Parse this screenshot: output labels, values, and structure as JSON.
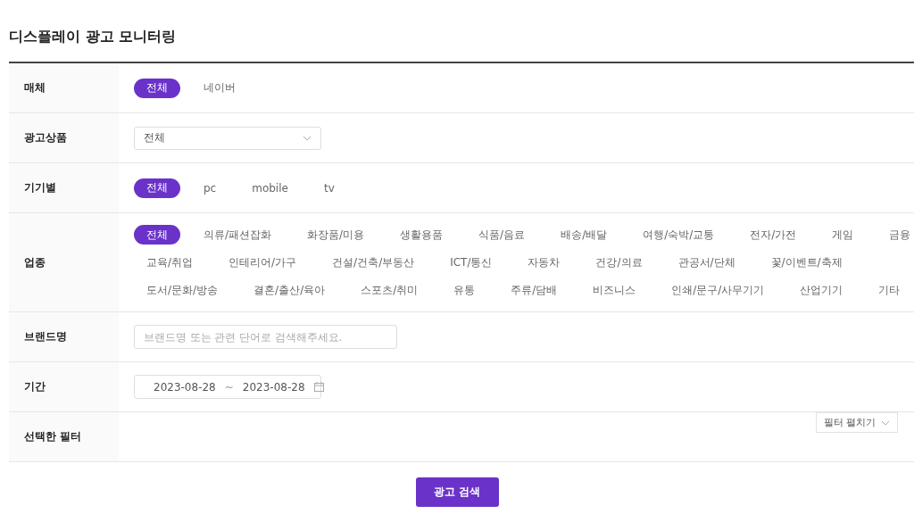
{
  "title": "디스플레이 광고 모니터링",
  "rows": [
    {
      "kind": "chips",
      "label": "매체",
      "options": [
        {
          "label": "전체",
          "selected": true
        },
        {
          "label": "네이버",
          "selected": false
        }
      ]
    },
    {
      "kind": "select",
      "label": "광고상품",
      "value": "전체"
    },
    {
      "kind": "chips",
      "label": "기기별",
      "options": [
        {
          "label": "전체",
          "selected": true
        },
        {
          "label": "pc",
          "selected": false
        },
        {
          "label": "mobile",
          "selected": false
        },
        {
          "label": "tv",
          "selected": false
        }
      ]
    },
    {
      "kind": "chip_lines",
      "label": "업종",
      "lines": [
        [
          {
            "label": "전체",
            "selected": true
          },
          {
            "label": "의류/패션잡화",
            "selected": false
          },
          {
            "label": "화장품/미용",
            "selected": false
          },
          {
            "label": "생활용품",
            "selected": false
          },
          {
            "label": "식품/음료",
            "selected": false
          },
          {
            "label": "배송/배달",
            "selected": false
          },
          {
            "label": "여행/숙박/교통",
            "selected": false
          },
          {
            "label": "전자/가전",
            "selected": false
          },
          {
            "label": "게임",
            "selected": false
          },
          {
            "label": "금융",
            "selected": false
          }
        ],
        [
          {
            "label": "교육/취업",
            "selected": false
          },
          {
            "label": "인테리어/가구",
            "selected": false
          },
          {
            "label": "건설/건축/부동산",
            "selected": false
          },
          {
            "label": "ICT/통신",
            "selected": false
          },
          {
            "label": "자동차",
            "selected": false
          },
          {
            "label": "건강/의료",
            "selected": false
          },
          {
            "label": "관공서/단체",
            "selected": false
          },
          {
            "label": "꽃/이벤트/축제",
            "selected": false
          }
        ],
        [
          {
            "label": "도서/문화/방송",
            "selected": false
          },
          {
            "label": "결혼/출산/육아",
            "selected": false
          },
          {
            "label": "스포츠/취미",
            "selected": false
          },
          {
            "label": "유통",
            "selected": false
          },
          {
            "label": "주류/담배",
            "selected": false
          },
          {
            "label": "비즈니스",
            "selected": false
          },
          {
            "label": "인쇄/문구/사무기기",
            "selected": false
          },
          {
            "label": "산업기기",
            "selected": false
          },
          {
            "label": "기타",
            "selected": false
          }
        ]
      ]
    },
    {
      "kind": "text",
      "label": "브랜드명",
      "placeholder": "브랜드명 또는 관련 단어로 검색해주세요."
    },
    {
      "kind": "dates",
      "label": "기간",
      "start": "2023-08-28",
      "separator": "~",
      "end": "2023-08-28"
    },
    {
      "kind": "filters",
      "label": "선택한 필터",
      "toggle": "필터 펼치기"
    }
  ],
  "search_button": "광고 검색"
}
